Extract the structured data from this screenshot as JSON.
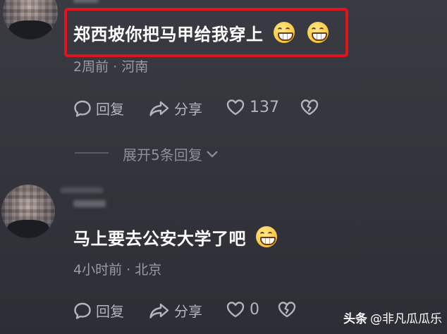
{
  "comments": [
    {
      "text": "郑西坡你把马甲给我穿上",
      "emojis": [
        "grin-emoji",
        "grin-emoji"
      ],
      "meta": "2周前 · 河南",
      "reply_label": "回复",
      "share_label": "分享",
      "likes": "137"
    },
    {
      "text": "马上要去公安大学了吧",
      "emojis": [
        "grin-emoji"
      ],
      "meta": "4小时前 · 北京",
      "reply_label": "回复",
      "share_label": "分享",
      "likes": "0"
    }
  ],
  "expand_replies": "展开5条回复",
  "watermark": {
    "brand": "头条",
    "account": "@非凡瓜瓜乐"
  },
  "colors": {
    "highlight": "#e1131f",
    "emoji": "#f7c94a"
  }
}
